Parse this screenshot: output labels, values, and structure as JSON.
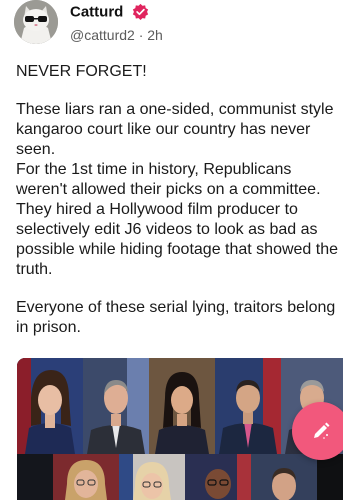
{
  "author": {
    "display_name": "Catturd",
    "handle": "@catturd2",
    "separator": "·",
    "timestamp": "2h",
    "avatar_icon": "cat-with-sunglasses-avatar",
    "verified_icon": "verified-badge-icon"
  },
  "post": {
    "lines": [
      "NEVER FORGET!",
      "",
      "These liars ran a one-sided, communist style",
      "kangaroo court like our country has never",
      "seen.",
      "For the 1st time in history, Republicans",
      "weren't allowed their picks on a committee.",
      "They hired a Hollywood film producer to",
      "selectively edit J6 videos to look as bad as",
      "possible while hiding footage that showed the",
      "truth.",
      "",
      "Everyone of these serial lying, traitors belong",
      "in prison."
    ]
  },
  "media": {
    "type": "photo-collage",
    "photo_count": 10
  },
  "compose_button": {
    "icon": "pencil-compose-icon"
  },
  "colors": {
    "accent": "#f2587c",
    "verified": "#e0245e",
    "handle": "#5b5b5b"
  }
}
